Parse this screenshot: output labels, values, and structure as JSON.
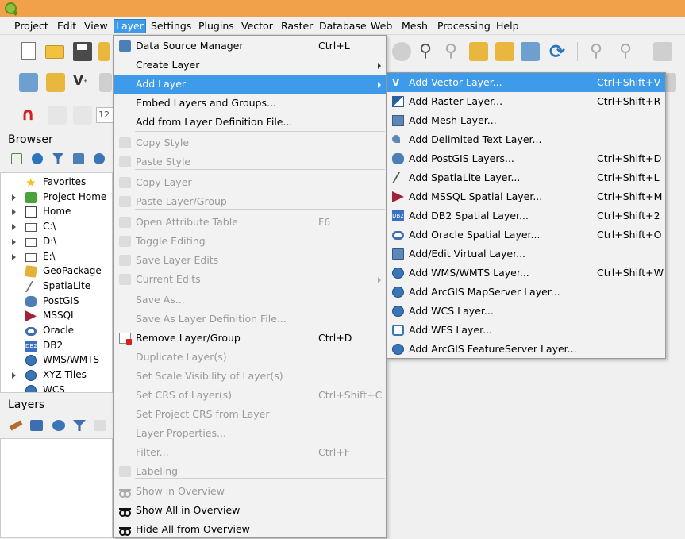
{
  "menubar": {
    "items": [
      "Project",
      "Edit",
      "View",
      "Layer",
      "Settings",
      "Plugins",
      "Vector",
      "Raster",
      "Database",
      "Web",
      "Mesh",
      "Processing",
      "Help"
    ],
    "active": "Layer"
  },
  "browser": {
    "title": "Browser",
    "items": [
      {
        "label": "Favorites",
        "icon": "star-icon",
        "expandable": false
      },
      {
        "label": "Project Home",
        "icon": "project-home-icon",
        "expandable": true
      },
      {
        "label": "Home",
        "icon": "home-icon",
        "expandable": true
      },
      {
        "label": "C:\\",
        "icon": "folder-icon",
        "expandable": true
      },
      {
        "label": "D:\\",
        "icon": "folder-icon",
        "expandable": true
      },
      {
        "label": "E:\\",
        "icon": "folder-icon",
        "expandable": true
      },
      {
        "label": "GeoPackage",
        "icon": "geopackage-icon",
        "expandable": false
      },
      {
        "label": "SpatiaLite",
        "icon": "spatialite-icon",
        "expandable": false
      },
      {
        "label": "PostGIS",
        "icon": "postgis-icon",
        "expandable": false
      },
      {
        "label": "MSSQL",
        "icon": "mssql-icon",
        "expandable": false
      },
      {
        "label": "Oracle",
        "icon": "oracle-icon",
        "expandable": false
      },
      {
        "label": "DB2",
        "icon": "db2-icon",
        "expandable": false
      },
      {
        "label": "WMS/WMTS",
        "icon": "globe-icon",
        "expandable": false
      },
      {
        "label": "XYZ Tiles",
        "icon": "globe-icon",
        "expandable": true
      },
      {
        "label": "WCS",
        "icon": "globe-icon",
        "expandable": false
      }
    ]
  },
  "layers_panel": {
    "title": "Layers"
  },
  "toolbar": {
    "scale_text": "12"
  },
  "layer_menu": {
    "items": [
      {
        "label": "Data Source Manager",
        "shortcut": "Ctrl+L",
        "icon": "data-source-manager-icon",
        "disabled": false,
        "submenu": false,
        "highlight": false
      },
      {
        "label": "Create Layer",
        "shortcut": "",
        "icon": "",
        "disabled": false,
        "submenu": true,
        "highlight": false
      },
      {
        "label": "Add Layer",
        "shortcut": "",
        "icon": "",
        "disabled": false,
        "submenu": true,
        "highlight": true
      },
      {
        "label": "Embed Layers and Groups...",
        "shortcut": "",
        "icon": "",
        "disabled": false,
        "submenu": false,
        "highlight": false
      },
      {
        "label": "Add from Layer Definition File...",
        "shortcut": "",
        "icon": "",
        "disabled": false,
        "submenu": false,
        "highlight": false
      },
      {
        "label": "Copy Style",
        "shortcut": "",
        "icon": "copy-style-icon",
        "disabled": true,
        "submenu": false,
        "highlight": false
      },
      {
        "label": "Paste Style",
        "shortcut": "",
        "icon": "paste-style-icon",
        "disabled": true,
        "submenu": false,
        "highlight": false
      },
      {
        "label": "Copy Layer",
        "shortcut": "",
        "icon": "copy-layer-icon",
        "disabled": true,
        "submenu": false,
        "highlight": false
      },
      {
        "label": "Paste Layer/Group",
        "shortcut": "",
        "icon": "paste-layer-icon",
        "disabled": true,
        "submenu": false,
        "highlight": false
      },
      {
        "label": "Open Attribute Table",
        "shortcut": "F6",
        "icon": "attribute-table-icon",
        "disabled": true,
        "submenu": false,
        "highlight": false
      },
      {
        "label": "Toggle Editing",
        "shortcut": "",
        "icon": "toggle-editing-icon",
        "disabled": true,
        "submenu": false,
        "highlight": false
      },
      {
        "label": "Save Layer Edits",
        "shortcut": "",
        "icon": "save-edits-icon",
        "disabled": true,
        "submenu": false,
        "highlight": false
      },
      {
        "label": "Current Edits",
        "shortcut": "",
        "icon": "current-edits-icon",
        "disabled": true,
        "submenu": true,
        "highlight": false
      },
      {
        "label": "Save As...",
        "shortcut": "",
        "icon": "",
        "disabled": true,
        "submenu": false,
        "highlight": false
      },
      {
        "label": "Save As Layer Definition File...",
        "shortcut": "",
        "icon": "",
        "disabled": true,
        "submenu": false,
        "highlight": false
      },
      {
        "label": "Remove Layer/Group",
        "shortcut": "Ctrl+D",
        "icon": "remove-layer-icon",
        "disabled": false,
        "submenu": false,
        "highlight": false
      },
      {
        "label": "Duplicate Layer(s)",
        "shortcut": "",
        "icon": "",
        "disabled": true,
        "submenu": false,
        "highlight": false
      },
      {
        "label": "Set Scale Visibility of Layer(s)",
        "shortcut": "",
        "icon": "",
        "disabled": true,
        "submenu": false,
        "highlight": false
      },
      {
        "label": "Set CRS of Layer(s)",
        "shortcut": "Ctrl+Shift+C",
        "icon": "",
        "disabled": true,
        "submenu": false,
        "highlight": false
      },
      {
        "label": "Set Project CRS from Layer",
        "shortcut": "",
        "icon": "",
        "disabled": true,
        "submenu": false,
        "highlight": false
      },
      {
        "label": "Layer Properties...",
        "shortcut": "",
        "icon": "",
        "disabled": true,
        "submenu": false,
        "highlight": false
      },
      {
        "label": "Filter...",
        "shortcut": "Ctrl+F",
        "icon": "",
        "disabled": true,
        "submenu": false,
        "highlight": false
      },
      {
        "label": "Labeling",
        "shortcut": "",
        "icon": "labeling-icon",
        "disabled": true,
        "submenu": false,
        "highlight": false
      },
      {
        "label": "Show in Overview",
        "shortcut": "",
        "icon": "show-in-overview-icon",
        "disabled": true,
        "submenu": false,
        "highlight": false
      },
      {
        "label": "Show All in Overview",
        "shortcut": "",
        "icon": "show-all-overview-icon",
        "disabled": false,
        "submenu": false,
        "highlight": false
      },
      {
        "label": "Hide All from Overview",
        "shortcut": "",
        "icon": "hide-all-overview-icon",
        "disabled": false,
        "submenu": false,
        "highlight": false
      }
    ]
  },
  "add_layer_submenu": {
    "items": [
      {
        "label": "Add Vector Layer...",
        "shortcut": "Ctrl+Shift+V",
        "icon": "vector-layer-icon",
        "highlight": true
      },
      {
        "label": "Add Raster Layer...",
        "shortcut": "Ctrl+Shift+R",
        "icon": "raster-layer-icon",
        "highlight": false
      },
      {
        "label": "Add Mesh Layer...",
        "shortcut": "",
        "icon": "mesh-layer-icon",
        "highlight": false
      },
      {
        "label": "Add Delimited Text Layer...",
        "shortcut": "",
        "icon": "delimited-text-icon",
        "highlight": false
      },
      {
        "label": "Add PostGIS Layers...",
        "shortcut": "Ctrl+Shift+D",
        "icon": "postgis-icon",
        "highlight": false
      },
      {
        "label": "Add SpatiaLite Layer...",
        "shortcut": "Ctrl+Shift+L",
        "icon": "spatialite-icon",
        "highlight": false
      },
      {
        "label": "Add MSSQL Spatial Layer...",
        "shortcut": "Ctrl+Shift+M",
        "icon": "mssql-icon",
        "highlight": false
      },
      {
        "label": "Add DB2 Spatial Layer...",
        "shortcut": "Ctrl+Shift+2",
        "icon": "db2-icon",
        "highlight": false
      },
      {
        "label": "Add Oracle Spatial Layer...",
        "shortcut": "Ctrl+Shift+O",
        "icon": "oracle-icon",
        "highlight": false
      },
      {
        "label": "Add/Edit Virtual Layer...",
        "shortcut": "",
        "icon": "virtual-layer-icon",
        "highlight": false
      },
      {
        "label": "Add WMS/WMTS Layer...",
        "shortcut": "Ctrl+Shift+W",
        "icon": "wms-globe-icon",
        "highlight": false
      },
      {
        "label": "Add ArcGIS MapServer Layer...",
        "shortcut": "",
        "icon": "arcgis-globe-icon",
        "highlight": false
      },
      {
        "label": "Add WCS Layer...",
        "shortcut": "",
        "icon": "wcs-globe-icon",
        "highlight": false
      },
      {
        "label": "Add WFS Layer...",
        "shortcut": "",
        "icon": "wfs-icon",
        "highlight": false
      },
      {
        "label": "Add ArcGIS FeatureServer Layer...",
        "shortcut": "",
        "icon": "arcgis-feature-icon",
        "highlight": false
      }
    ]
  },
  "colors": {
    "accent": "#3d9be9",
    "titlebar": "#f0a14a",
    "disabled_text": "#9a9a9a"
  }
}
